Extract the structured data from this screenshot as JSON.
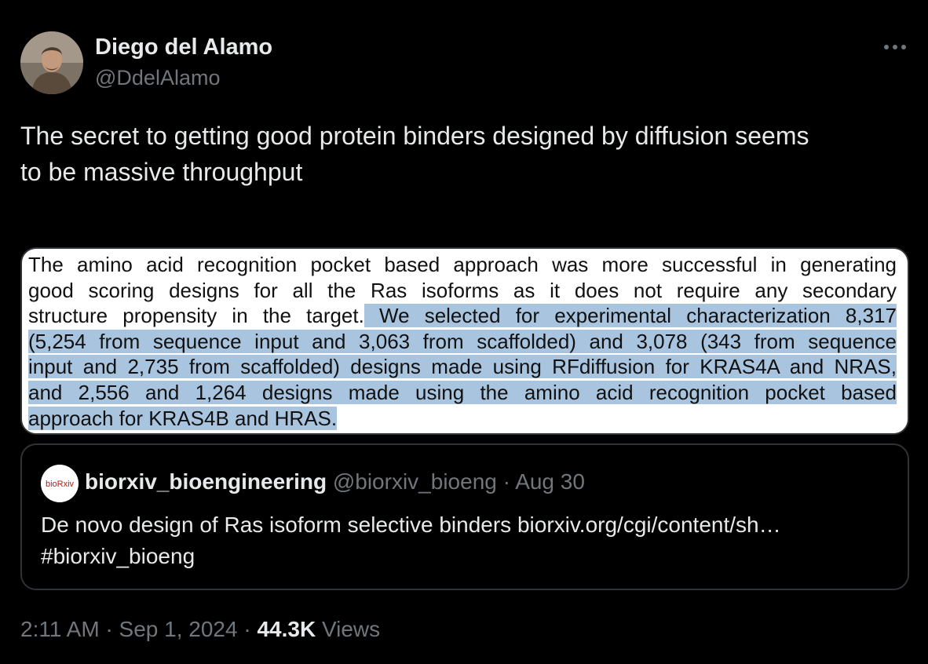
{
  "author": {
    "name": "Diego del Alamo",
    "handle": "@DdelAlamo"
  },
  "tweet": {
    "text_line1": "The secret to getting good protein binders designed by diffusion seems",
    "text_line2": "to be massive throughput"
  },
  "media": {
    "lines": [
      {
        "plain": "The amino acid recognition pocket based approach was more successful in generating",
        "hl": ""
      },
      {
        "plain": "good scoring designs for all the Ras isoforms as it does not require any secondary",
        "hl": ""
      },
      {
        "plain": "structure propensity in the target.",
        "hl": " We selected for experimental characterization 8,317"
      },
      {
        "plain": "",
        "hl": "(5,254 from sequence input and 3,063 from scaffolded) and 3,078 (343 from sequence"
      },
      {
        "plain": "",
        "hl": "input and 2,735 from scaffolded) designs made using RFdiffusion for KRAS4A and NRAS,"
      },
      {
        "plain": "",
        "hl": "and 2,556 and 1,264 designs made using the amino acid recognition pocket based"
      },
      {
        "plain": "",
        "hl": "approach",
        "tail_hl": " for KRAS4B and HRAS. "
      }
    ]
  },
  "quote": {
    "avatar_text": "bioRxiv",
    "name": "biorxiv_bioengineering",
    "handle": "@biorxiv_bioeng",
    "separator": "·",
    "date": "Aug 30",
    "text_line1": "De novo design of Ras isoform selective binders  biorxiv.org/cgi/content/sh…",
    "text_line2": "#biorxiv_bioeng"
  },
  "meta": {
    "time": "2:11 AM",
    "sep1": "·",
    "date": "Sep 1, 2024",
    "sep2": "·",
    "views_count": "44.3K",
    "views_label": "Views"
  },
  "icons": {
    "more": "more-horizontal-icon"
  }
}
